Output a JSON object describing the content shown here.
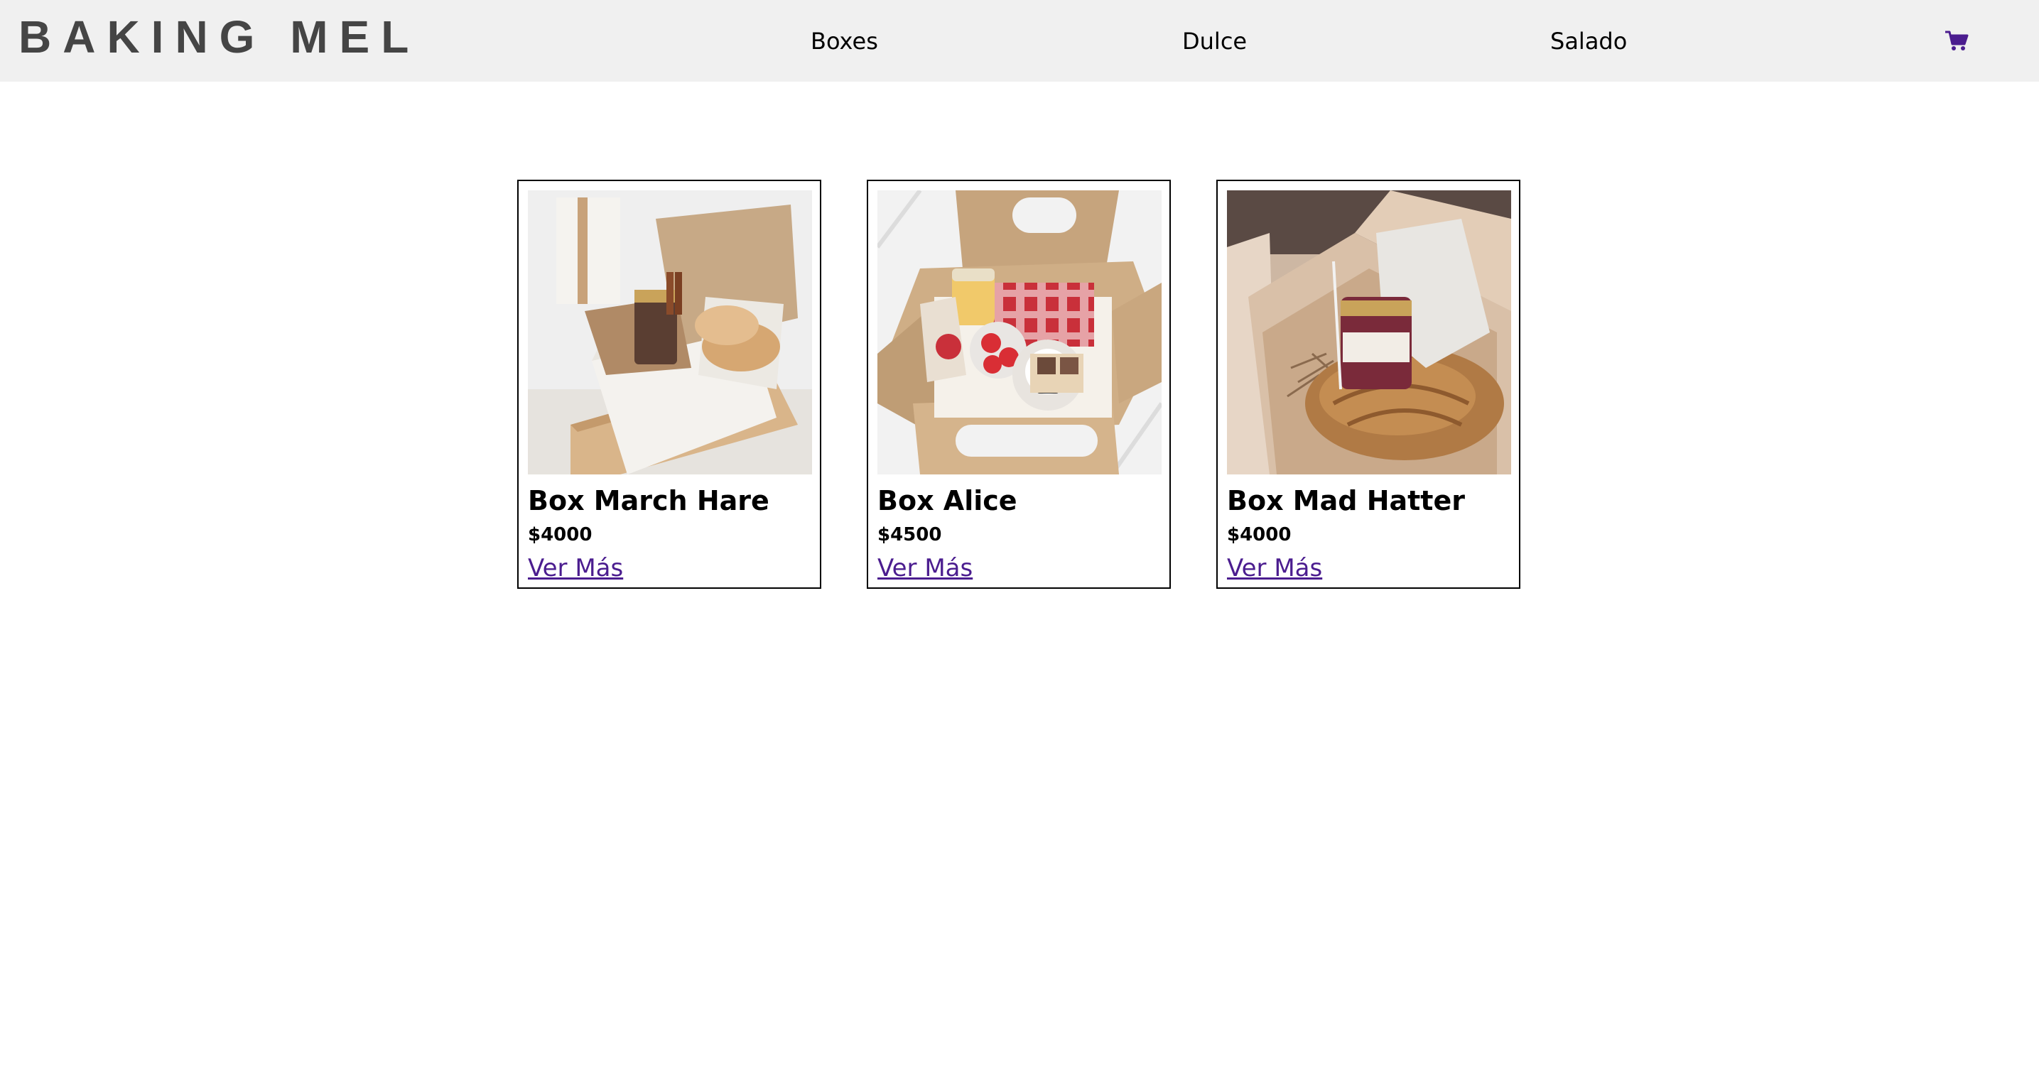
{
  "header": {
    "brand": "BAKING MEL",
    "nav": [
      {
        "label": "Boxes"
      },
      {
        "label": "Dulce"
      },
      {
        "label": "Salado"
      }
    ],
    "cart_icon": "shopping-cart-icon",
    "cart_color": "#4b1d8f"
  },
  "products": [
    {
      "name": "Box March Hare",
      "price": "$4000",
      "link": "Ver Más",
      "image": "box-march-hare-photo"
    },
    {
      "name": "Box Alice",
      "price": "$4500",
      "link": "Ver Más",
      "image": "box-alice-photo"
    },
    {
      "name": "Box Mad Hatter",
      "price": "$4000",
      "link": "Ver Más",
      "image": "box-mad-hatter-photo"
    }
  ],
  "colors": {
    "navbar_bg": "#f0f0f0",
    "brand_text": "#454545",
    "link": "#4b1d8f"
  }
}
